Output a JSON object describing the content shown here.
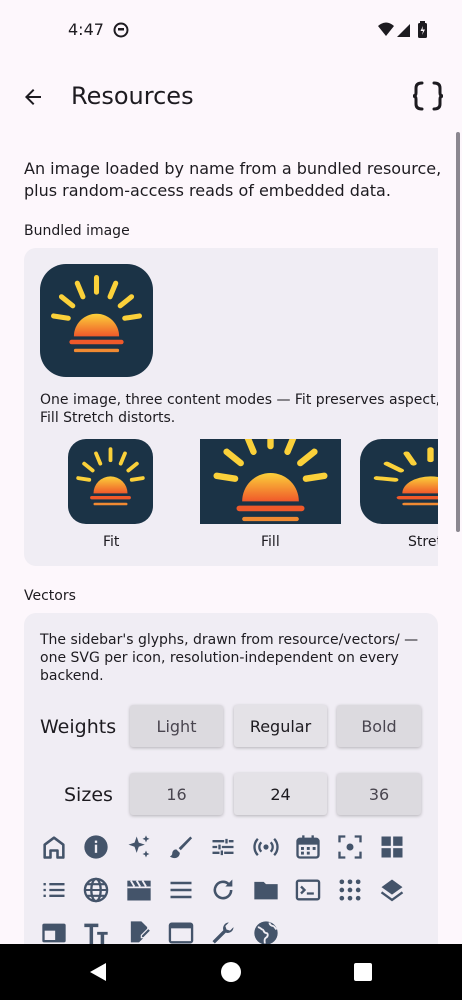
{
  "status_bar": {
    "time": "4:47",
    "left_icon": "circle-face-icon",
    "right_icons": [
      "wifi-icon",
      "cell-signal-icon",
      "battery-charging-icon"
    ]
  },
  "app_bar": {
    "title": "Resources",
    "back_icon": "arrow-back-icon",
    "action_icon": "code-braces-icon"
  },
  "intro": "An image loaded by name from a bundled resource, plus random-access reads of embedded data.",
  "bundled": {
    "section_label": "Bundled image",
    "caption": "One image, three content modes — Fit preserves aspect, Fill Stretch distorts.",
    "modes": [
      {
        "label": "Fit"
      },
      {
        "label": "Fill"
      },
      {
        "label": "Stret"
      }
    ]
  },
  "vectors": {
    "section_label": "Vectors",
    "description": "The sidebar's glyphs, drawn from resource/vectors/ — one SVG per icon, resolution-independent on every backend.",
    "weights": {
      "label": "Weights",
      "options": [
        "Light",
        "Regular",
        "Bold"
      ],
      "selected": "Regular"
    },
    "sizes": {
      "label": "Sizes",
      "options": [
        "16",
        "24",
        "36"
      ],
      "selected": "24"
    },
    "icons": [
      "home-icon",
      "info-icon",
      "sparkle-icon",
      "brush-icon",
      "tune-icon",
      "broadcast-icon",
      "calendar-icon",
      "center-focus-icon",
      "dashboard-icon",
      "list-icon",
      "globe-icon",
      "movie-icon",
      "menu-icon",
      "refresh-icon",
      "folder-icon",
      "terminal-icon",
      "apps-grid-icon",
      "layers-icon",
      "picture-in-picture-icon",
      "text-fields-icon",
      "edit-document-icon",
      "window-icon",
      "wrench-icon",
      "public-globe-icon"
    ]
  },
  "colors": {
    "background": "#fdf7fc",
    "card": "#f0edf4",
    "icon": "#44546a",
    "image_bg": "#1b3346",
    "sun_top": "#fbd13a",
    "sun_bottom": "#f0592a"
  }
}
